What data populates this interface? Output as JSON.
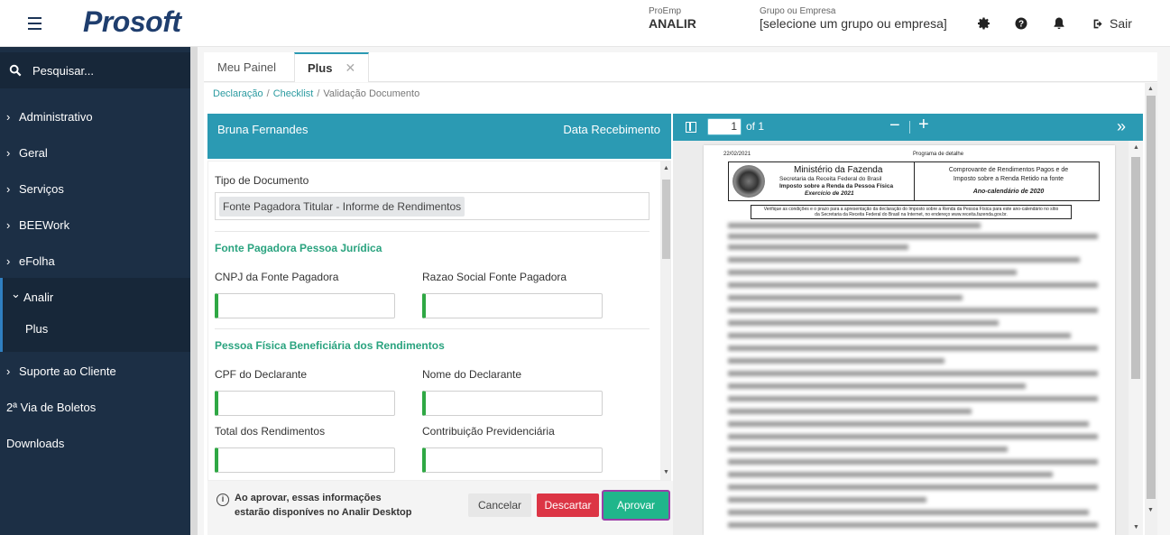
{
  "header": {
    "logo": "Prosoft",
    "proemp_label": "ProEmp",
    "proemp_value": "ANALIR",
    "grupo_label": "Grupo ou Empresa",
    "grupo_value": "[selecione um grupo ou empresa]",
    "sair_label": "Sair",
    "icons": [
      "menu-icon",
      "gear-icon",
      "help-icon",
      "bell-icon",
      "logout-icon"
    ]
  },
  "sidebar": {
    "search_placeholder": "Pesquisar...",
    "items": [
      {
        "label": "Administrativo",
        "chevron": "›"
      },
      {
        "label": "Geral",
        "chevron": "›"
      },
      {
        "label": "Serviços",
        "chevron": "›"
      },
      {
        "label": "BEEWork",
        "chevron": "›"
      },
      {
        "label": "eFolha",
        "chevron": "›"
      },
      {
        "label": "Analir",
        "chevron": "⌄"
      },
      {
        "label": "Plus",
        "chevron": ""
      },
      {
        "label": "Suporte ao Cliente",
        "chevron": "›"
      },
      {
        "label": "2ª Via de Boletos",
        "chevron": ""
      },
      {
        "label": "Downloads",
        "chevron": ""
      }
    ]
  },
  "tabs": [
    {
      "label": "Meu Painel"
    },
    {
      "label": "Plus",
      "close": "✕"
    }
  ],
  "breadcrumb": {
    "items": [
      "Declaração",
      "Checklist",
      "Validação Documento"
    ],
    "sep": "/"
  },
  "form": {
    "header_name": "Bruna Fernandes",
    "header_date": "Data Recebimento",
    "tipo_label": "Tipo de Documento",
    "tipo_value": "Fonte Pagadora Titular - Informe de Rendimentos",
    "section1": "Fonte Pagadora Pessoa Jurídica",
    "cnpj_label": "CNPJ da Fonte Pagadora",
    "razao_label": "Razao Social Fonte Pagadora",
    "section2": "Pessoa Física Beneficiária dos Rendimentos",
    "cpf_label": "CPF do Declarante",
    "nome_label": "Nome do Declarante",
    "total_label": "Total dos Rendimentos",
    "contrib_label": "Contribuição Previdenciária"
  },
  "footer": {
    "info_line1": "Ao aprovar, essas informações",
    "info_line2": "estarão disponíves no Analir Desktop",
    "cancel": "Cancelar",
    "descartar": "Descartar",
    "aprovar": "Aprovar"
  },
  "pdf": {
    "page_value": "1",
    "page_of": "of 1",
    "zoom_out": "−",
    "zoom_in": "+",
    "more": "»",
    "doc_date": "22/02/2021",
    "doc_program": "Programa de detalhe",
    "doc_ministerio": "Ministério da Fazenda",
    "doc_secretaria": "Secretaria da Receita Federal do Brasil",
    "doc_imposto": "Imposto sobre a Renda da Pessoa Física",
    "doc_exercicio": "Exercício de 2021",
    "doc_comprovante_1": "Comprovante de Rendimentos Pagos e de",
    "doc_comprovante_2": "Imposto sobre a Renda Retido na fonte",
    "doc_ano": "Ano-calendário de 2020",
    "doc_note_1": "Verifique as condições e o prazo para a apresentação da declaração do Imposto sobre a Renda da Pessoa Física para este ano-calendário no sítio",
    "doc_note_2": "da Secretaria da Receita Federal do Brasil na Internet, no endereço www.receita.fazenda.gov.br."
  },
  "colors": {
    "sidebar_bg": "#1c2f45",
    "accent_teal": "#2b9ab3",
    "section_green": "#2aa37f",
    "danger": "#dc3545",
    "approve": "#20b68b"
  }
}
